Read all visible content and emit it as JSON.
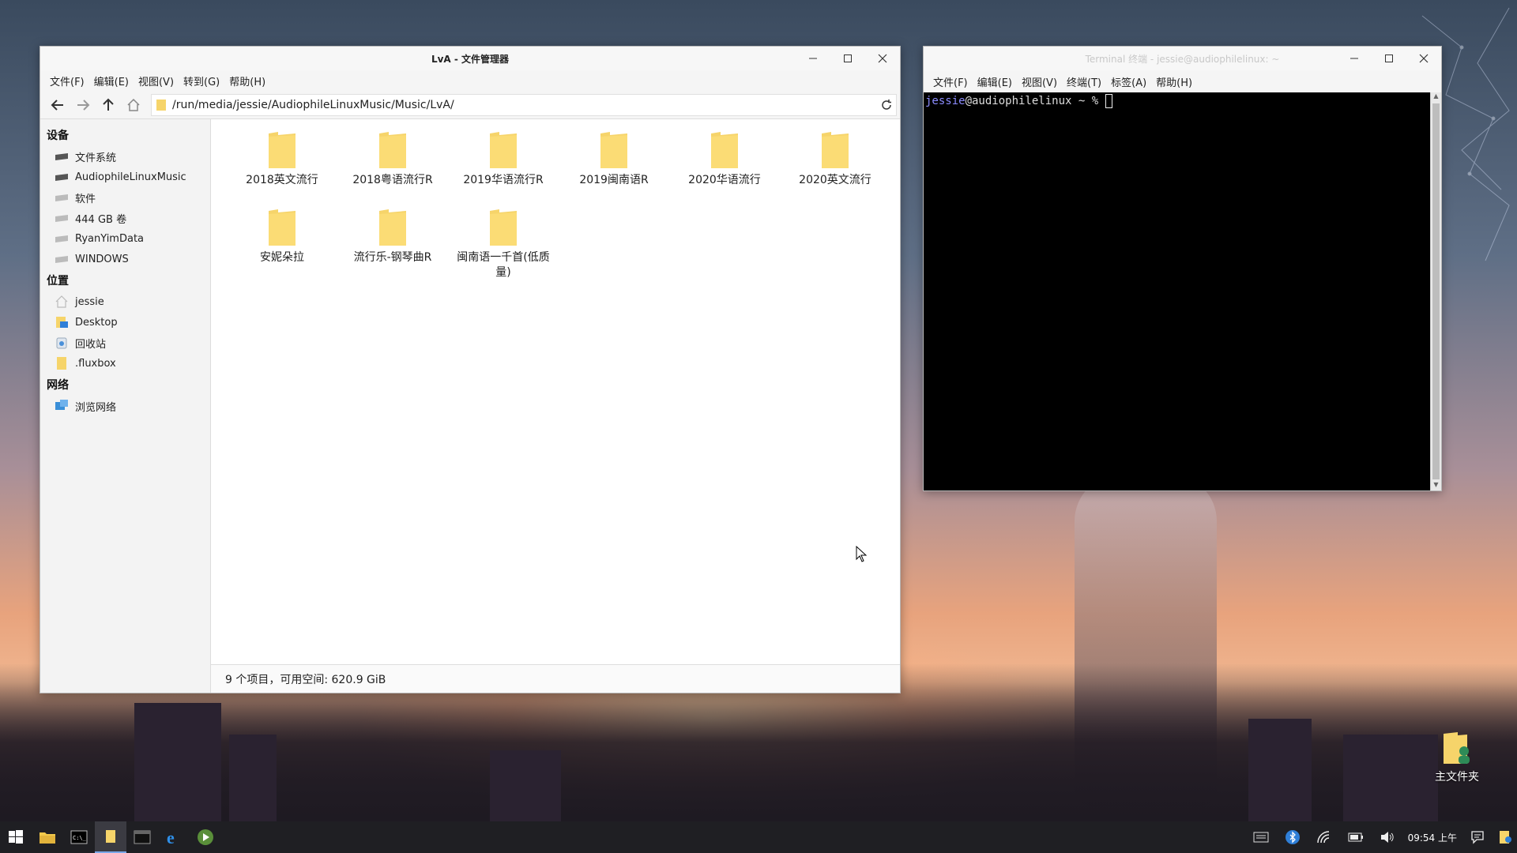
{
  "file_manager": {
    "title": "LvA - 文件管理器",
    "menu": [
      "文件(F)",
      "编辑(E)",
      "视图(V)",
      "转到(G)",
      "帮助(H)"
    ],
    "path": "/run/media/jessie/AudiophileLinuxMusic/Music/LvA/",
    "sidebar": {
      "devices_heading": "设备",
      "devices": [
        "文件系统",
        "AudiophileLinuxMusic",
        "软件",
        "444 GB 卷",
        "RyanYimData",
        "WINDOWS"
      ],
      "places_heading": "位置",
      "places": [
        "jessie",
        "Desktop",
        "回收站",
        ".fluxbox"
      ],
      "network_heading": "网络",
      "network": [
        "浏览网络"
      ]
    },
    "files": [
      "2018英文流行",
      "2018粤语流行R",
      "2019华语流行R",
      "2019闽南语R",
      "2020华语流行",
      "2020英文流行",
      "安妮朵拉",
      "流行乐-钢琴曲R",
      "闽南语一千首(低质量)"
    ],
    "status": "9 个项目，可用空间: 620.9 GiB"
  },
  "terminal": {
    "title": "Terminal 终端 - jessie@audiophilelinux: ~",
    "menu": [
      "文件(F)",
      "编辑(E)",
      "视图(V)",
      "终端(T)",
      "标签(A)",
      "帮助(H)"
    ],
    "prompt_user": "jessie",
    "prompt_host": "@audiophilelinux ~ % "
  },
  "desktop": {
    "home_folder_label": "主文件夹"
  },
  "taskbar": {
    "clock": "09:54 上午"
  },
  "colors": {
    "folder": "#f6d46a",
    "terminal_bg": "#000000",
    "prompt_user": "#8c8cff",
    "taskbar": "#1f1f23"
  }
}
